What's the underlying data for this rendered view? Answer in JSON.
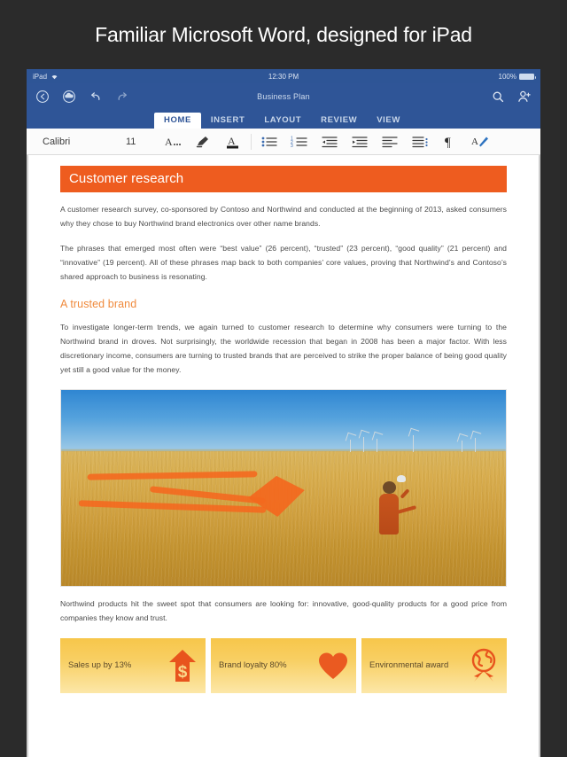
{
  "promo": {
    "headline": "Familiar Microsoft Word, designed for iPad"
  },
  "status_bar": {
    "device_label": "iPad",
    "wifi_icon": "wifi-icon",
    "time": "12:30 PM",
    "battery_percent": "100%",
    "battery_icon": "battery-full-icon"
  },
  "app_bar": {
    "document_title": "Business Plan",
    "left_icons": [
      {
        "name": "back-icon",
        "label": "Back"
      },
      {
        "name": "cloud-save-icon",
        "label": "Save to cloud"
      },
      {
        "name": "undo-icon",
        "label": "Undo"
      },
      {
        "name": "redo-icon",
        "label": "Redo"
      }
    ],
    "right_icons": [
      {
        "name": "search-icon",
        "label": "Search"
      },
      {
        "name": "add-person-icon",
        "label": "Share"
      }
    ]
  },
  "ribbon": {
    "tabs": [
      {
        "label": "HOME",
        "active": true
      },
      {
        "label": "INSERT",
        "active": false
      },
      {
        "label": "LAYOUT",
        "active": false
      },
      {
        "label": "REVIEW",
        "active": false
      },
      {
        "label": "VIEW",
        "active": false
      }
    ]
  },
  "format_bar": {
    "font_family": "Calibri",
    "font_size": "11",
    "buttons": [
      {
        "name": "font-formatting-icon",
        "label": "Font formatting"
      },
      {
        "name": "highlighter-icon",
        "label": "Text highlight color"
      },
      {
        "name": "font-color-icon",
        "label": "Font color"
      },
      {
        "name": "bullet-list-icon",
        "label": "Bullets"
      },
      {
        "name": "numbered-list-icon",
        "label": "Numbering"
      },
      {
        "name": "decrease-indent-icon",
        "label": "Decrease indent"
      },
      {
        "name": "increase-indent-icon",
        "label": "Increase indent"
      },
      {
        "name": "align-icon",
        "label": "Alignment"
      },
      {
        "name": "line-spacing-icon",
        "label": "Line spacing"
      },
      {
        "name": "pilcrow-icon",
        "label": "Show formatting marks"
      },
      {
        "name": "format-painter-icon",
        "label": "Styles"
      }
    ]
  },
  "document": {
    "heading": "Customer research",
    "paragraph_1": "A customer research survey, co-sponsored by Contoso and Northwind and conducted at the beginning of 2013, asked consumers why they chose to buy Northwind brand electronics over other name brands.",
    "paragraph_2": "The phrases that emerged most often were “best value” (26 percent), “trusted” (23 percent), “good quality” (21 percent) and “innovative” (19 percent). All of these phrases map back to both companies’ core values, proving that Northwind’s and Contoso’s shared approach to business is resonating.",
    "subheading": "A trusted brand",
    "paragraph_3": "To investigate longer-term trends, we again turned to customer research to determine why consumers were turning to the Northwind brand in droves. Not surprisingly, the worldwide recession that began in 2008 has been a major factor. With less discretionary income, consumers are turning to trusted brands that are perceived to strike the proper balance of being good quality yet still a good value for the money.",
    "image_alt": "Child flying an orange kite in a wheat field with wind turbines",
    "paragraph_4": "Northwind products hit the sweet spot that consumers are looking for: innovative, good-quality products for a good price from companies they know and trust.",
    "callouts": [
      {
        "text": "Sales up by 13%",
        "icon": "dollar-up-arrow-icon"
      },
      {
        "text": "Brand loyalty 80%",
        "icon": "heart-icon"
      },
      {
        "text": "Environmental award",
        "icon": "globe-award-icon"
      }
    ]
  },
  "colors": {
    "accent_orange": "#EE5C1F",
    "subheading_orange": "#F08A3C",
    "ribbon_blue": "#2F5597",
    "callout_gold": "#F7C64A",
    "page_background": "#2B2B2B"
  }
}
